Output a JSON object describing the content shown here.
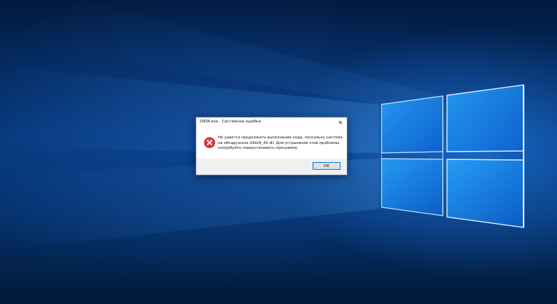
{
  "dialog": {
    "title": "DATA.exe - Системная ошибка",
    "message": "Не удается продолжить выполнение кода, поскольку система не обнаружила d3dx9_42.dll. Для устранения этой проблемы попробуйте переустановить программу.",
    "ok_label": "OK",
    "close_icon": "close-icon",
    "error_icon": "error-icon"
  },
  "colors": {
    "desktop_accent": "#1e8cff",
    "dialog_bg": "#ffffff",
    "footer_bg": "#f0f0f0",
    "button_border": "#0078d7",
    "error_red": "#d32f2f"
  }
}
